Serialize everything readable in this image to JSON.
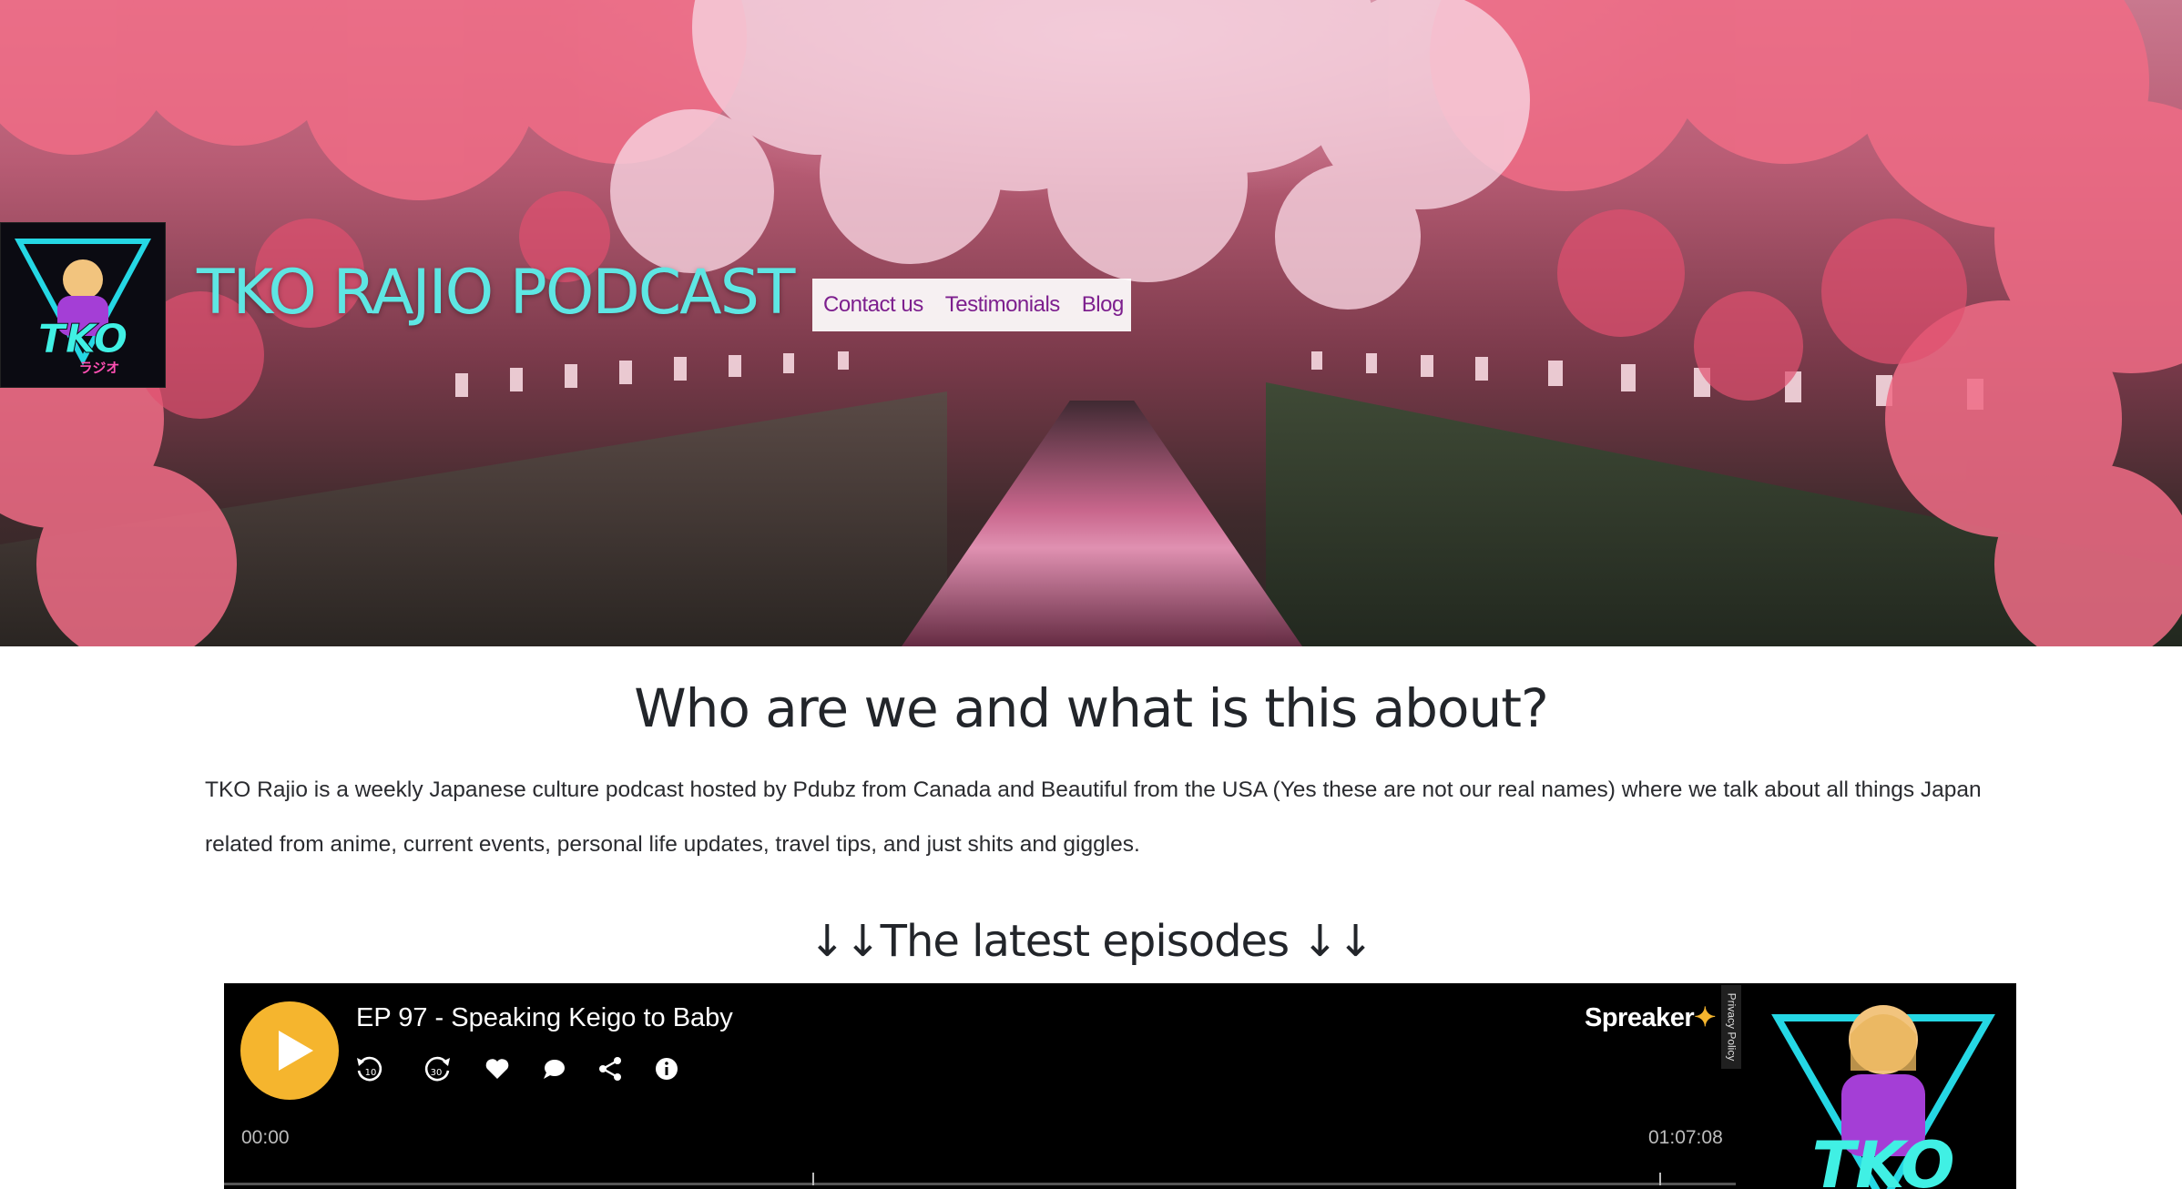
{
  "site": {
    "title": "TKO RAJIO PODCAST",
    "logo_alt": "TKO ラジオ"
  },
  "nav": {
    "items": [
      {
        "label": "Contact us"
      },
      {
        "label": "Testimonials"
      },
      {
        "label": "Blog"
      }
    ]
  },
  "about": {
    "heading": "Who are we and what is this about?",
    "body": "TKO Rajio is a weekly Japanese culture podcast hosted by Pdubz from Canada and Beautiful from the USA (Yes these are not our real names) where we talk about all things Japan related from anime, current events, personal life updates, travel tips, and just shits and giggles."
  },
  "latest": {
    "heading": "↓↓The latest episodes ↓↓"
  },
  "player": {
    "episode_title": "EP 97 - Speaking Keigo to Baby",
    "time_elapsed": "00:00",
    "time_total": "01:07:08",
    "brand": "Spreaker",
    "privacy_label": "Privacy Policy",
    "controls": [
      "rewind-10-icon",
      "forward-30-icon",
      "heart-icon",
      "comment-icon",
      "share-icon",
      "info-icon"
    ],
    "rewind_label": "10",
    "forward_label": "30",
    "progress": 0.0
  },
  "colors": {
    "title": "#5ee6e3",
    "nav_link": "#7d1f8e",
    "play_button": "#f5b52e",
    "player_bg": "#000000"
  }
}
